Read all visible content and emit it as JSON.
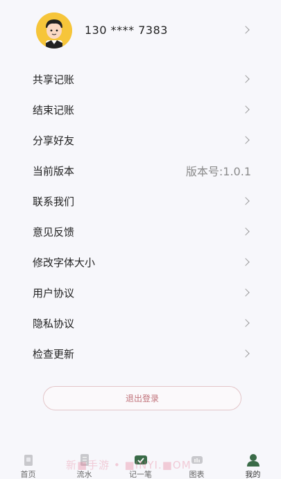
{
  "profile": {
    "phone": "130 **** 7383",
    "avatar_icon": "avatar-cartoon-man-icon"
  },
  "menu": [
    {
      "label": "共享记账"
    },
    {
      "label": "结束记账"
    },
    {
      "label": "分享好友"
    },
    {
      "label": "当前版本",
      "value": "版本号:1.0.1"
    },
    {
      "label": "联系我们"
    },
    {
      "label": "意见反馈"
    },
    {
      "label": "修改字体大小"
    },
    {
      "label": "用户协议"
    },
    {
      "label": "隐私协议"
    },
    {
      "label": "检查更新"
    }
  ],
  "logout": {
    "label": "退出登录"
  },
  "tabbar": [
    {
      "label": "首页",
      "icon": "home-icon"
    },
    {
      "label": "流水",
      "icon": "list-icon"
    },
    {
      "label": "记一笔",
      "icon": "add-record-icon"
    },
    {
      "label": "图表",
      "icon": "chart-icon"
    },
    {
      "label": "我的",
      "icon": "user-icon"
    }
  ],
  "watermark": "新■手游 • ■INYI.■OM",
  "colors": {
    "accent": "#3a6b48",
    "logout_text": "#c0727a",
    "avatar_bg": "#f6c53a"
  }
}
